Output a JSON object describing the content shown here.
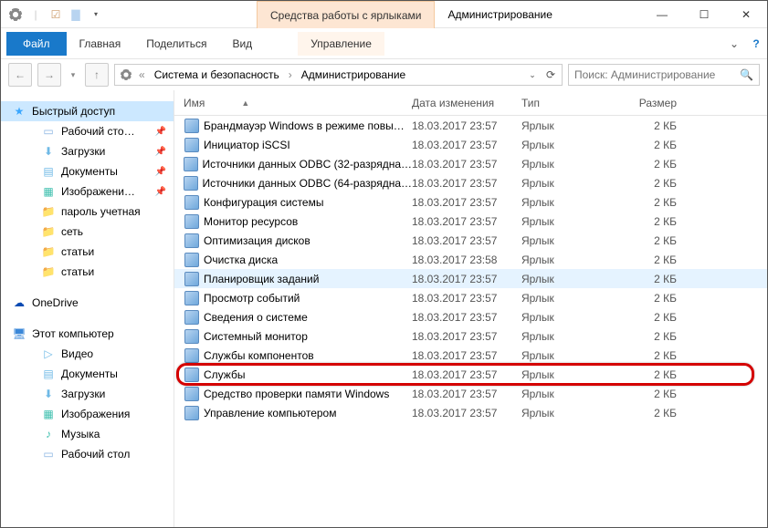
{
  "title_tools_tab": "Средства работы с ярлыками",
  "window_title": "Администрирование",
  "ribbon": {
    "file": "Файл",
    "home": "Главная",
    "share": "Поделиться",
    "view": "Вид",
    "manage": "Управление"
  },
  "breadcrumbs": [
    "Система и безопасность",
    "Администрирование"
  ],
  "search_placeholder": "Поиск: Администрирование",
  "columns": {
    "name": "Имя",
    "date": "Дата изменения",
    "type": "Тип",
    "size": "Размер"
  },
  "nav": {
    "quick": "Быстрый доступ",
    "quick_items": [
      {
        "label": "Рабочий сто…",
        "icon": "drive",
        "pinned": true
      },
      {
        "label": "Загрузки",
        "icon": "dl",
        "pinned": true
      },
      {
        "label": "Документы",
        "icon": "doc",
        "pinned": true
      },
      {
        "label": "Изображени…",
        "icon": "img",
        "pinned": true
      },
      {
        "label": "пароль учетная",
        "icon": "folder",
        "pinned": false
      },
      {
        "label": "сеть",
        "icon": "folder",
        "pinned": false
      },
      {
        "label": "статьи",
        "icon": "folder",
        "pinned": false
      },
      {
        "label": "статьи",
        "icon": "folder",
        "pinned": false
      }
    ],
    "onedrive": "OneDrive",
    "this_pc": "Этот компьютер",
    "pc_items": [
      {
        "label": "Видео",
        "icon": "video"
      },
      {
        "label": "Документы",
        "icon": "doc"
      },
      {
        "label": "Загрузки",
        "icon": "dl"
      },
      {
        "label": "Изображения",
        "icon": "img"
      },
      {
        "label": "Музыка",
        "icon": "music"
      },
      {
        "label": "Рабочий стол",
        "icon": "drive"
      }
    ]
  },
  "rows": [
    {
      "name": "Брандмауэр Windows в режиме повы…",
      "date": "18.03.2017 23:57",
      "type": "Ярлык",
      "size": "2 КБ",
      "hover": false,
      "hl": false
    },
    {
      "name": "Инициатор iSCSI",
      "date": "18.03.2017 23:57",
      "type": "Ярлык",
      "size": "2 КБ",
      "hover": false,
      "hl": false
    },
    {
      "name": "Источники данных ODBC (32-разрядна…",
      "date": "18.03.2017 23:57",
      "type": "Ярлык",
      "size": "2 КБ",
      "hover": false,
      "hl": false
    },
    {
      "name": "Источники данных ODBC (64-разрядна…",
      "date": "18.03.2017 23:57",
      "type": "Ярлык",
      "size": "2 КБ",
      "hover": false,
      "hl": false
    },
    {
      "name": "Конфигурация системы",
      "date": "18.03.2017 23:57",
      "type": "Ярлык",
      "size": "2 КБ",
      "hover": false,
      "hl": false
    },
    {
      "name": "Монитор ресурсов",
      "date": "18.03.2017 23:57",
      "type": "Ярлык",
      "size": "2 КБ",
      "hover": false,
      "hl": false
    },
    {
      "name": "Оптимизация дисков",
      "date": "18.03.2017 23:57",
      "type": "Ярлык",
      "size": "2 КБ",
      "hover": false,
      "hl": false
    },
    {
      "name": "Очистка диска",
      "date": "18.03.2017 23:58",
      "type": "Ярлык",
      "size": "2 КБ",
      "hover": false,
      "hl": false
    },
    {
      "name": "Планировщик заданий",
      "date": "18.03.2017 23:57",
      "type": "Ярлык",
      "size": "2 КБ",
      "hover": true,
      "hl": false
    },
    {
      "name": "Просмотр событий",
      "date": "18.03.2017 23:57",
      "type": "Ярлык",
      "size": "2 КБ",
      "hover": false,
      "hl": false
    },
    {
      "name": "Сведения о системе",
      "date": "18.03.2017 23:57",
      "type": "Ярлык",
      "size": "2 КБ",
      "hover": false,
      "hl": false
    },
    {
      "name": "Системный монитор",
      "date": "18.03.2017 23:57",
      "type": "Ярлык",
      "size": "2 КБ",
      "hover": false,
      "hl": false
    },
    {
      "name": "Службы компонентов",
      "date": "18.03.2017 23:57",
      "type": "Ярлык",
      "size": "2 КБ",
      "hover": false,
      "hl": false
    },
    {
      "name": "Службы",
      "date": "18.03.2017 23:57",
      "type": "Ярлык",
      "size": "2 КБ",
      "hover": false,
      "hl": true
    },
    {
      "name": "Средство проверки памяти Windows",
      "date": "18.03.2017 23:57",
      "type": "Ярлык",
      "size": "2 КБ",
      "hover": false,
      "hl": false
    },
    {
      "name": "Управление компьютером",
      "date": "18.03.2017 23:57",
      "type": "Ярлык",
      "size": "2 КБ",
      "hover": false,
      "hl": false
    }
  ]
}
